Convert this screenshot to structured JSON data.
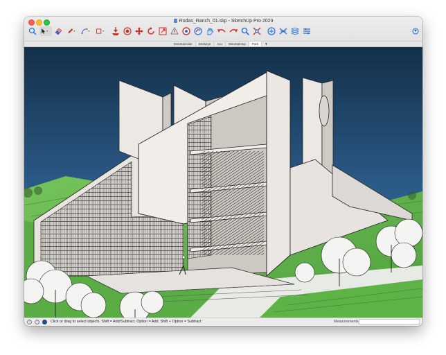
{
  "window": {
    "title": "Rodas_Ranch_01.skp - SketchUp Pro 2023"
  },
  "toolbar": {
    "tools": [
      {
        "name": "search-icon",
        "color": "#2b6cd1"
      },
      {
        "name": "select-arrow-icon",
        "color": "#222222"
      },
      {
        "name": "eraser-icon",
        "color": "#d8485a"
      },
      {
        "name": "pencil-icon",
        "color": "#c0392b"
      },
      {
        "name": "arc-icon",
        "color": "#2b6cd1"
      },
      {
        "name": "rectangle-icon",
        "color": "#c0392b"
      },
      {
        "name": "push-pull-icon",
        "color": "#c0392b"
      },
      {
        "name": "offset-icon",
        "color": "#c0392b"
      },
      {
        "name": "move-icon",
        "color": "#d12b2b"
      },
      {
        "name": "rotate-icon",
        "color": "#d12b2b"
      },
      {
        "name": "scale-icon",
        "color": "#d12b2b"
      },
      {
        "name": "tape-measure-icon",
        "color": "#777777"
      },
      {
        "name": "paint-bucket-icon",
        "color": "#d12b2b"
      },
      {
        "name": "orbit-icon",
        "color": "#2b6cd1"
      },
      {
        "name": "pan-icon",
        "color": "#2b6cd1"
      },
      {
        "name": "previous-view-icon",
        "color": "#d12b2b"
      },
      {
        "name": "next-view-icon",
        "color": "#d12b2b"
      },
      {
        "name": "zoom-icon",
        "color": "#2b6cd1"
      },
      {
        "name": "zoom-extents-icon",
        "color": "#d12b2b"
      },
      {
        "name": "warehouse-icon",
        "color": "#2b6cd1"
      },
      {
        "name": "extension-warehouse-icon",
        "color": "#2b6cd1"
      },
      {
        "name": "layout-icon",
        "color": "#2b6cd1"
      },
      {
        "name": "style-builder-icon",
        "color": "#2b6cd1"
      },
      {
        "name": "account-icon",
        "color": "#2b6cd1"
      }
    ]
  },
  "scene_tabs": {
    "items": [
      "Mountainside",
      "Birdseye",
      "Axo",
      "Mountaintop",
      "Park"
    ],
    "active": "Park",
    "menu_icon": "▼"
  },
  "status": {
    "hint": "Click or drag to select objects. Shift = Add/Subtract. Option = Add. Shift + Option = Subtract.",
    "measurements_label": "Measurements",
    "measurements_value": ""
  }
}
